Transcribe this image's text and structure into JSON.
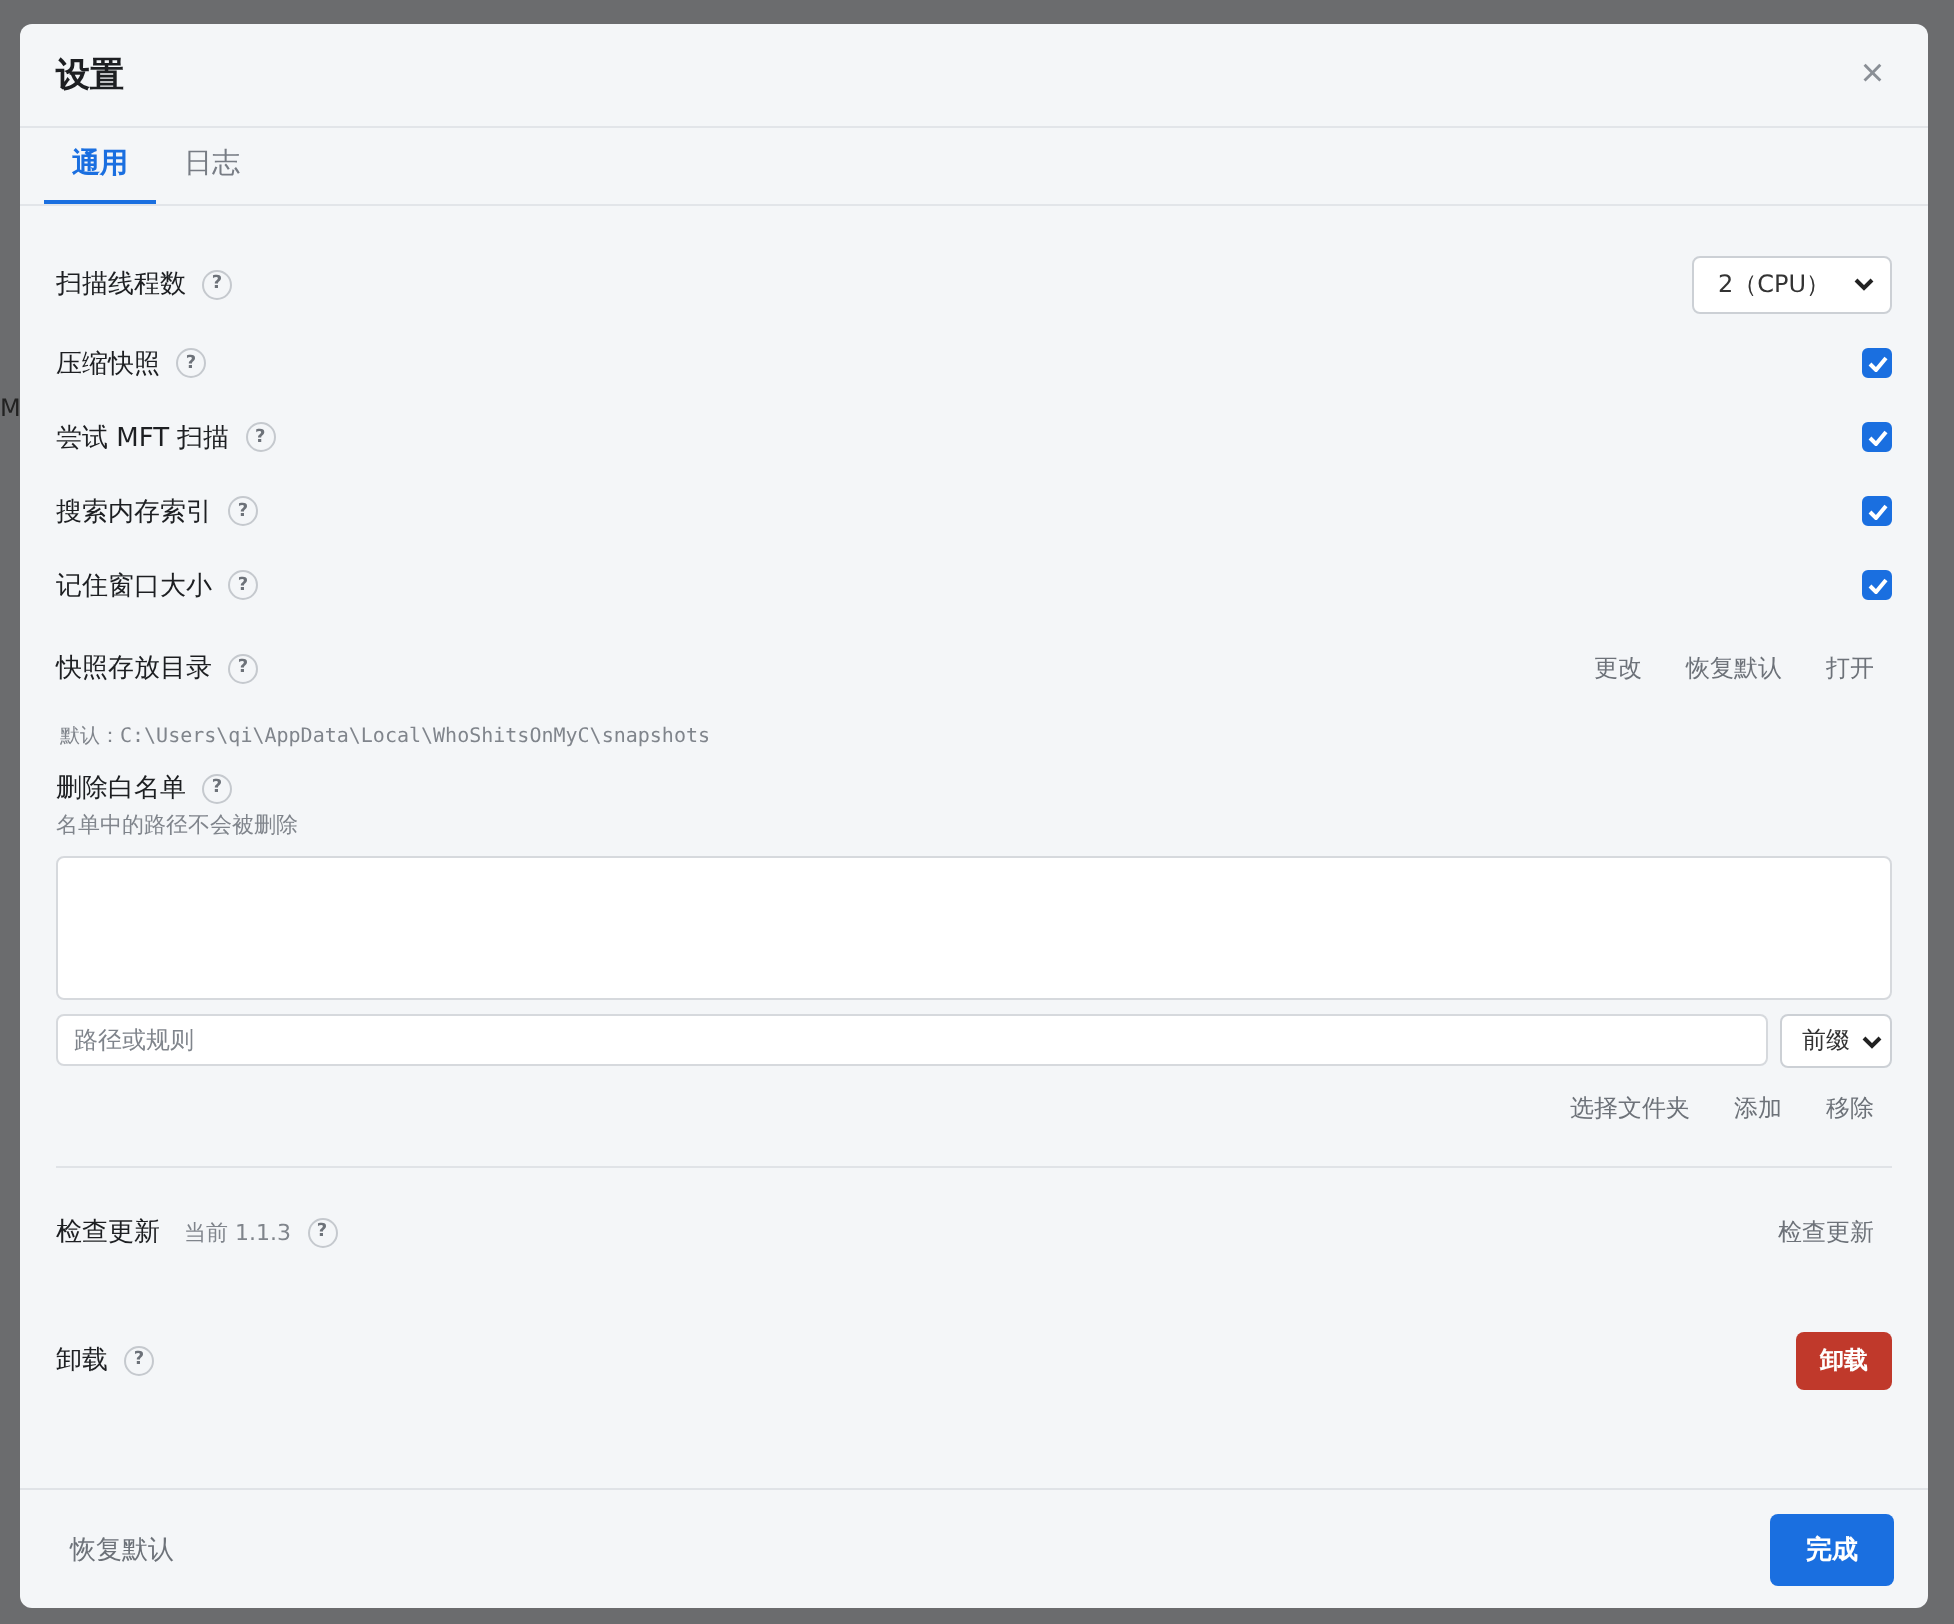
{
  "background_text": "M",
  "window": {
    "title": "设置",
    "close": "×"
  },
  "tabs": [
    {
      "label": "通用",
      "selected": true
    },
    {
      "label": "日志",
      "selected": false
    }
  ],
  "thread_setting": {
    "label": "扫描线程数",
    "help": "?",
    "value": "2（CPU）"
  },
  "toggles": [
    {
      "label": "压缩快照",
      "help": "?",
      "checked": true
    },
    {
      "label": "尝试 MFT 扫描",
      "help": "?",
      "checked": true
    },
    {
      "label": "搜索内存索引",
      "help": "?",
      "checked": true
    },
    {
      "label": "记住窗口大小",
      "help": "?",
      "checked": true
    }
  ],
  "snapshot_dir": {
    "label": "快照存放目录",
    "help": "?",
    "actions": [
      "更改",
      "恢复默认",
      "打开"
    ],
    "default_path": "默认：C:\\Users\\qi\\AppData\\Local\\WhoShitsOnMyC\\snapshots"
  },
  "whitelist": {
    "label": "删除白名单",
    "help": "?",
    "hint": "名单中的路径不会被删除",
    "input": {
      "placeholder": "路径或规则"
    },
    "mode": "前缀",
    "actions": [
      "选择文件夹",
      "添加",
      "移除"
    ]
  },
  "update": {
    "label": "检查更新",
    "current": "当前 1.1.3",
    "help": "?",
    "action": "检查更新"
  },
  "uninstall": {
    "label": "卸载",
    "help": "?",
    "action": "卸载"
  },
  "footer": {
    "reset": "恢复默认",
    "done": "完成"
  }
}
